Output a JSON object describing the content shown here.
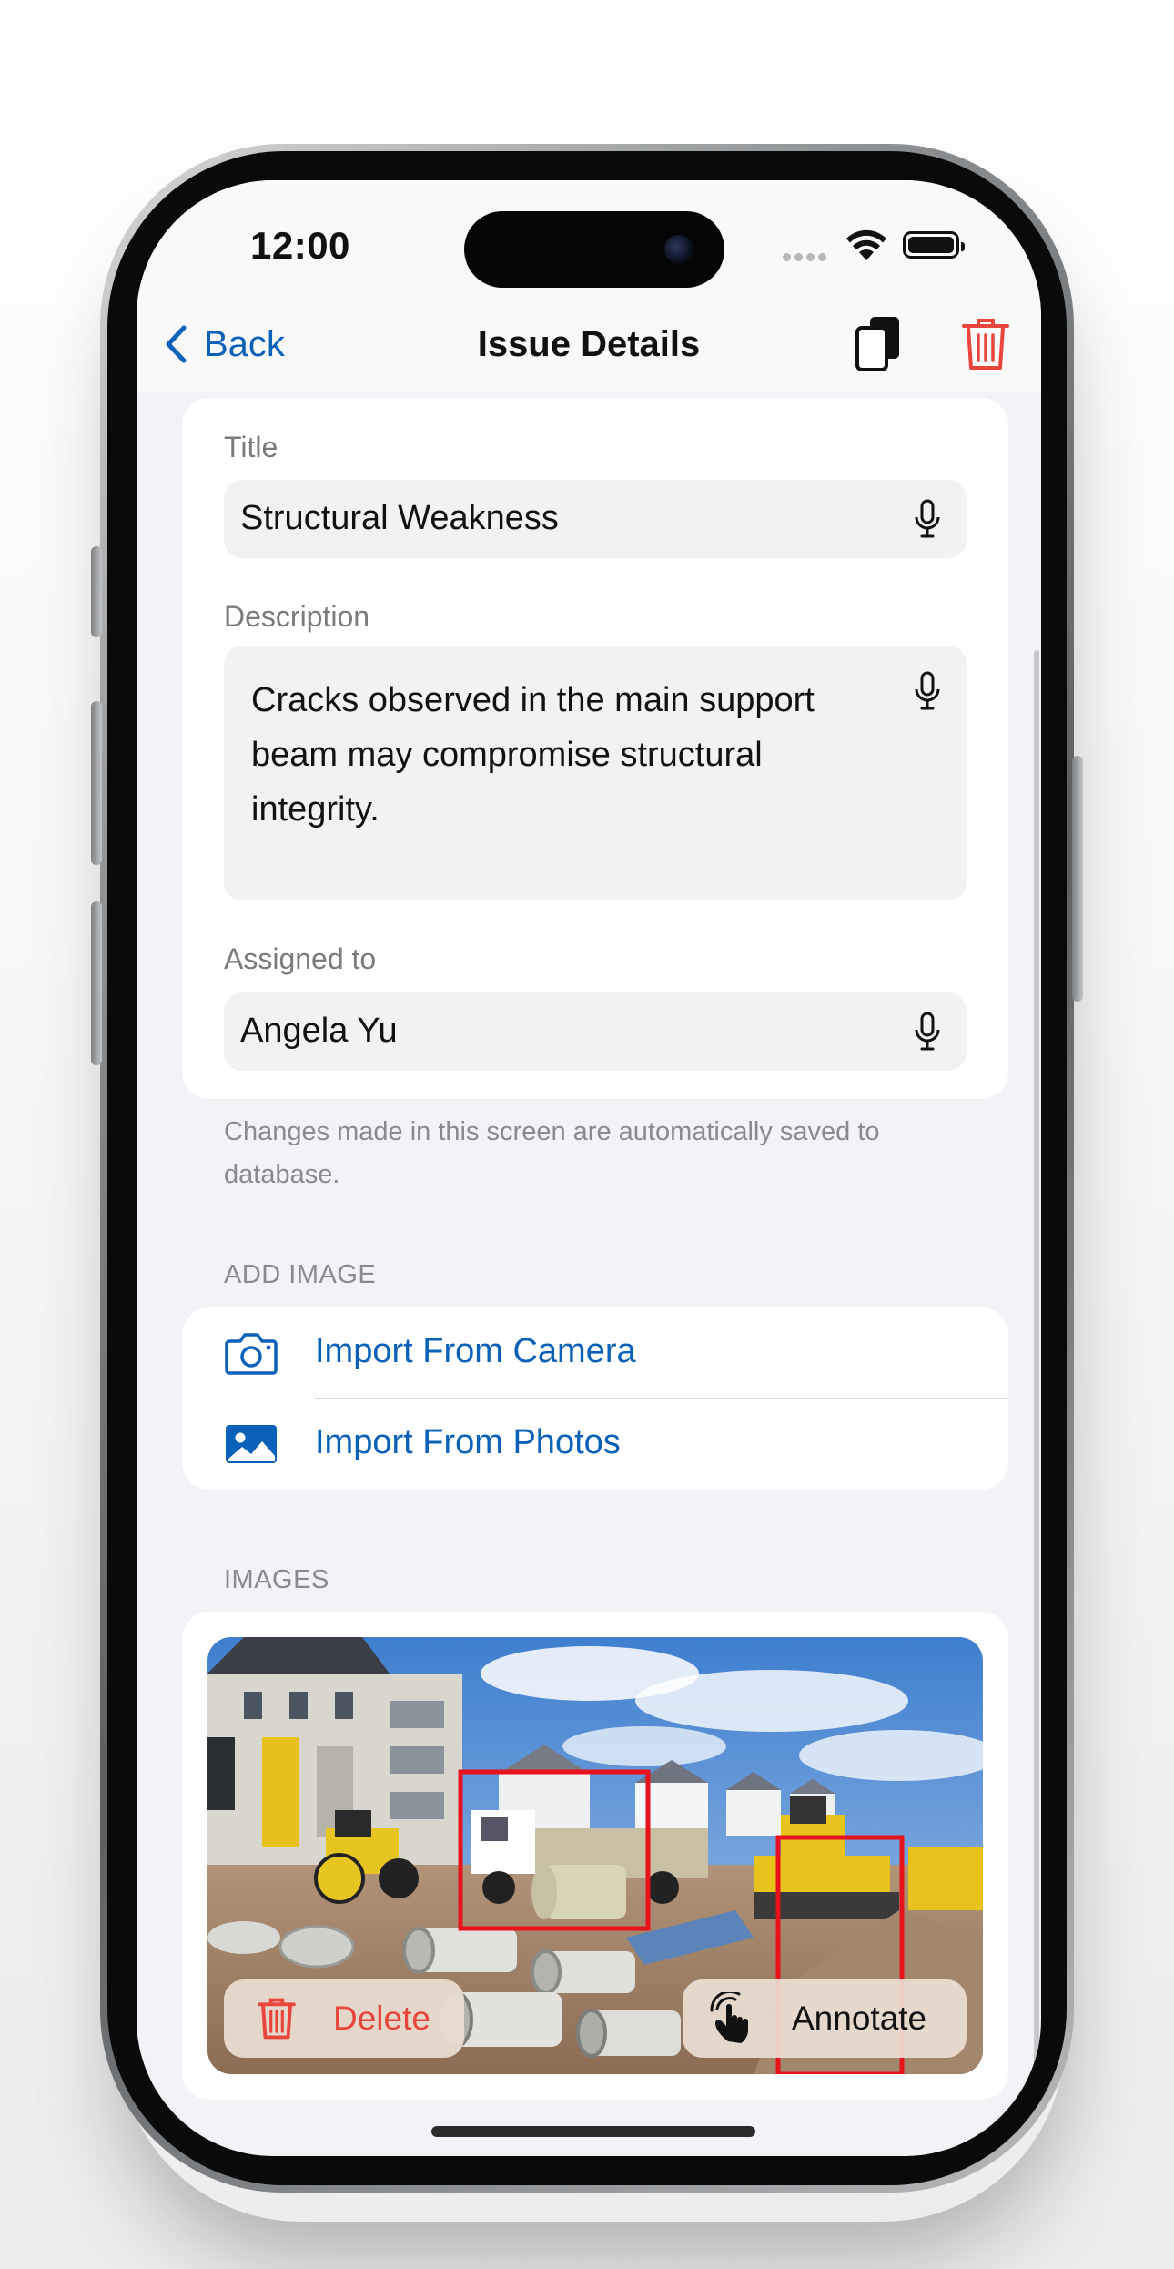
{
  "status_bar": {
    "time": "12:00"
  },
  "nav": {
    "back_label": "Back",
    "title": "Issue Details",
    "accent_color": "#0a61b8",
    "destructive_color": "#e8453c"
  },
  "form": {
    "title": {
      "label": "Title",
      "value": "Structural Weakness"
    },
    "description": {
      "label": "Description",
      "value": "Cracks observed in the main support beam may compromise structural integrity."
    },
    "assigned": {
      "label": "Assigned to",
      "value": "Angela Yu"
    },
    "footnote": "Changes made in this screen are automatically saved to database."
  },
  "add_image": {
    "header": "ADD IMAGE",
    "camera_label": "Import From Camera",
    "photos_label": "Import From Photos"
  },
  "images": {
    "header": "IMAGES",
    "delete_label": "Delete",
    "annotate_label": "Annotate"
  },
  "icons": [
    "chevron-left-icon",
    "copy-icon",
    "trash-icon",
    "microphone-icon",
    "camera-icon",
    "photo-icon",
    "hand-tap-icon"
  ]
}
